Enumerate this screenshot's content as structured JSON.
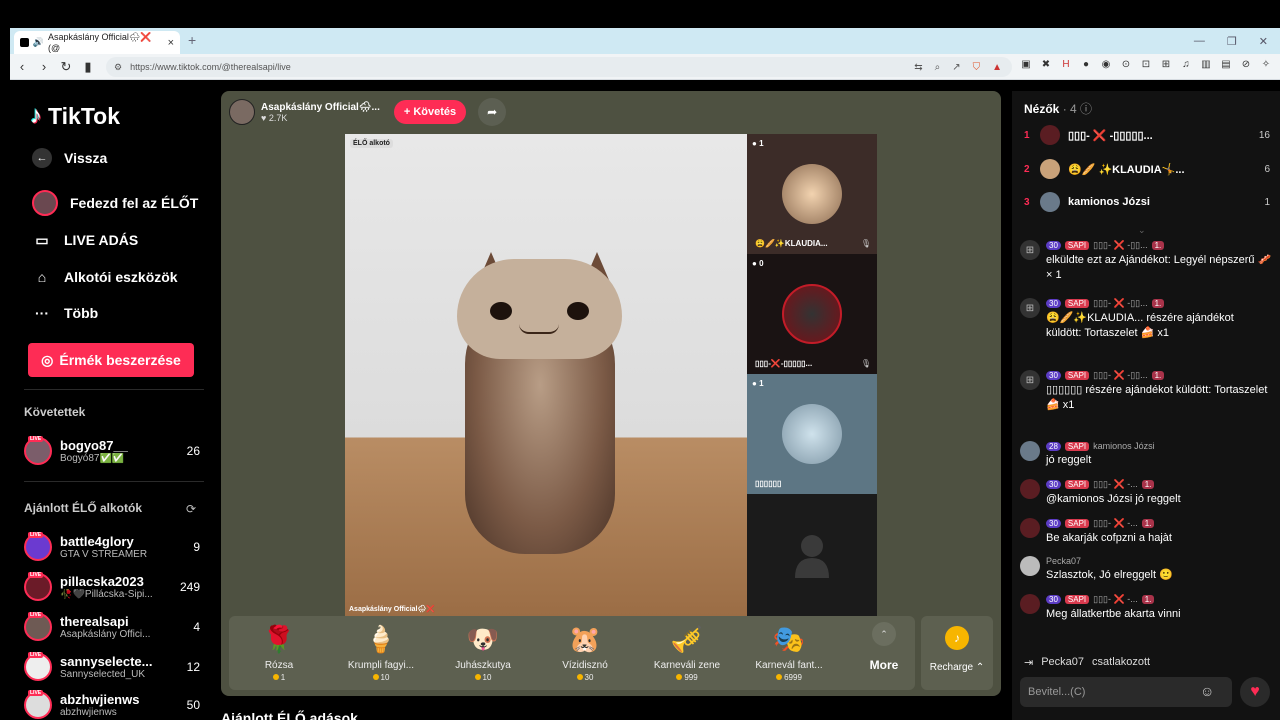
{
  "browser": {
    "tab_title": "Asapkáslány Official🌧❌ (@",
    "url": "https://www.tiktok.com/@therealsapi/live"
  },
  "sidebar": {
    "brand": "TikTok",
    "back": "Vissza",
    "nav": [
      {
        "label": "Fedezd fel az ÉLŐT",
        "icon": "explore-avatar-icon"
      },
      {
        "label": "LIVE ADÁS",
        "icon": "camera-icon"
      },
      {
        "label": "Alkotói eszközök",
        "icon": "home-icon"
      },
      {
        "label": "Több",
        "icon": "more-dots-icon"
      }
    ],
    "coins_button": "Érmék beszerzése",
    "followed_header": "Követettek",
    "followed": [
      {
        "name": "bogyo87__",
        "sub": "Bogyó87✅✅",
        "count": "26"
      }
    ],
    "recommended_header": "Ajánlott ÉLŐ alkotók",
    "recommended": [
      {
        "name": "battle4glory",
        "sub": "GTA V STREAMER",
        "count": "9"
      },
      {
        "name": "pillacska2023",
        "sub": "🥀🖤Pillácska-Sipi...",
        "count": "249"
      },
      {
        "name": "therealsapi",
        "sub": "Asapkáslány Offici...",
        "count": "4"
      },
      {
        "name": "sannyselecte...",
        "sub": "Sannyselected_UK",
        "count": "12"
      },
      {
        "name": "abzhwjienws",
        "sub": "abzhwjienws",
        "count": "50"
      }
    ],
    "live_badge": "LIVE"
  },
  "stream": {
    "host_name": "Asapkáslány Official🌧...",
    "host_likes": "♥ 2.7K",
    "follow_button": "+ Követés",
    "video_tag": "ÉLŐ alkotó",
    "video_caption": "Asapkáslány Official🌧❌",
    "guests": [
      {
        "badge": "1",
        "name": "😩🥖✨KLAUDIA..."
      },
      {
        "badge": "0",
        "name": "▯▯▯-❌-▯▯▯▯▯..."
      },
      {
        "badge": "1",
        "name": "▯▯▯▯▯▯"
      },
      {
        "badge": "",
        "name": ""
      }
    ],
    "gifts": [
      {
        "name": "Rózsa",
        "price": "1",
        "icon": "🌹"
      },
      {
        "name": "Krumpli fagyi...",
        "price": "10",
        "icon": "🍦"
      },
      {
        "name": "Juhászkutya",
        "price": "10",
        "icon": "🐶"
      },
      {
        "name": "Vízidisznó",
        "price": "30",
        "icon": "🐹"
      },
      {
        "name": "Karneváli zene",
        "price": "999",
        "icon": "🎺"
      },
      {
        "name": "Karnevál fant...",
        "price": "6999",
        "icon": "🎭"
      }
    ],
    "more": "More",
    "recharge": "Recharge ⌃",
    "recommended_title": "Ajánlott ÉLŐ adások"
  },
  "chat": {
    "viewers_title": "Nézők",
    "viewers_count": "· 4",
    "viewers": [
      {
        "rank": "1",
        "name": "▯▯▯- ❌ -▯▯▯▯▯...",
        "count": "16"
      },
      {
        "rank": "2",
        "name": "😩🥖 ✨KLAUDIA🤸...",
        "count": "6"
      },
      {
        "rank": "3",
        "name": "kamionos Józsi",
        "count": "1"
      }
    ],
    "messages": [
      {
        "icon": "🎁",
        "lvl": "30",
        "sapi": "SAPI",
        "user": "▯▯▯- ❌ -▯▯...",
        "one": "1.",
        "text": "elküldte ezt az Ajándékot: Legyél népszerű 🥓 × 1"
      },
      {
        "icon": "🎁",
        "lvl": "30",
        "sapi": "SAPI",
        "user": "▯▯▯- ❌ -▯▯...",
        "one": "1.",
        "text": "😩🥖✨KLAUDIA... részére ajándékot küldött: Tortaszelet 🍰 x1"
      },
      {
        "icon": "🎁",
        "lvl": "30",
        "sapi": "SAPI",
        "user": "▯▯▯- ❌ -▯▯...",
        "one": "1.",
        "text": "▯▯▯▯▯▯ részére ajándékot küldött: Tortaszelet 🍰 x1"
      },
      {
        "icon": "",
        "lvl": "28",
        "sapi": "SAPI",
        "user": "kamionos Józsi",
        "one": "",
        "text": "jó reggelt"
      },
      {
        "icon": "",
        "lvl": "30",
        "sapi": "SAPI",
        "user": "▯▯▯- ❌ -...",
        "one": "1.",
        "text": "@kamionos Józsi jó reggelt"
      },
      {
        "icon": "",
        "lvl": "30",
        "sapi": "SAPI",
        "user": "▯▯▯- ❌ -...",
        "one": "1.",
        "text": "Be akarják cofpzni a hajàt"
      },
      {
        "icon": "",
        "lvl": "",
        "sapi": "",
        "user": "Pecka07",
        "one": "",
        "text": "Szlasztok, Jó elreggelt 🙂"
      },
      {
        "icon": "",
        "lvl": "30",
        "sapi": "SAPI",
        "user": "▯▯▯- ❌ -...",
        "one": "1.",
        "text": "Meg állatkertbe akarta vinni"
      }
    ],
    "joined_user": "Pecka07",
    "joined_text": "csatlakozott",
    "input_placeholder": "Bevitel...(C)"
  },
  "colors": {
    "accent": "#fe2c55",
    "stream_bg": "#4e5141"
  }
}
